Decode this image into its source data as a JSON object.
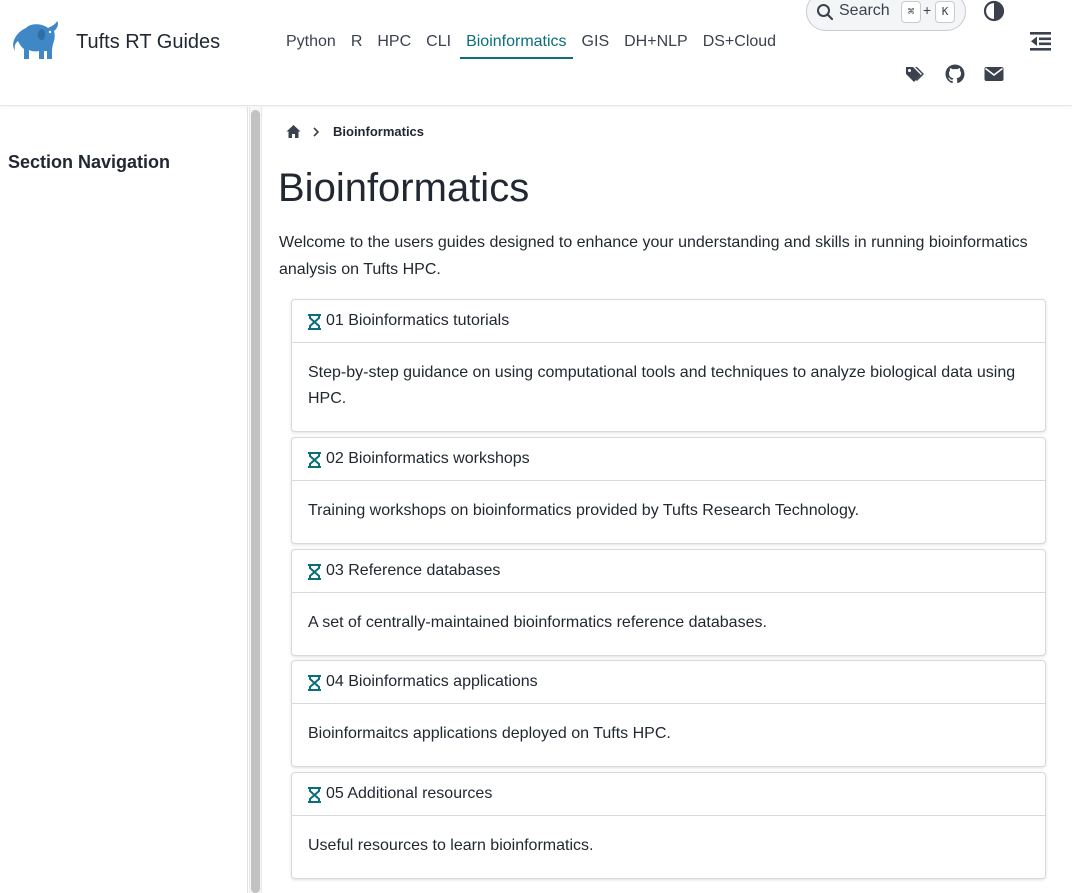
{
  "header": {
    "brand": "Tufts RT Guides",
    "nav": [
      "Python",
      "R",
      "HPC",
      "CLI",
      "Bioinformatics",
      "GIS",
      "DH+NLP",
      "DS+Cloud"
    ],
    "active_nav": "Bioinformatics",
    "search": {
      "label": "Search",
      "shortcut_mod": "⌘",
      "shortcut_plus": "+",
      "shortcut_key": "K"
    },
    "icons": [
      "tags-icon",
      "github-icon",
      "envelope-icon",
      "theme-toggle-icon",
      "toc-toggle-icon",
      "elephant-logo"
    ]
  },
  "sidebar": {
    "title": "Section Navigation"
  },
  "breadcrumb": {
    "current": "Bioinformatics"
  },
  "main": {
    "title": "Bioinformatics",
    "intro": "Welcome to the users guides designed to enhance your understanding and skills in running bioinformatics analysis on Tufts HPC.",
    "cards": [
      {
        "title": "01 Bioinformatics tutorials",
        "body": "Step-by-step guidance on using computational tools and techniques to analyze biological data using HPC."
      },
      {
        "title": "02 Bioinformatics workshops",
        "body": "Training workshops on bioinformatics provided by Tufts Research Technology."
      },
      {
        "title": "03 Reference databases",
        "body": "A set of centrally-maintained bioinformatics reference databases."
      },
      {
        "title": "04 Bioinformatics applications",
        "body": "Bioinformaitcs applications deployed on Tufts HPC."
      },
      {
        "title": "05 Additional resources",
        "body": "Useful resources to learn bioinformatics."
      }
    ]
  },
  "colors": {
    "accent": "#0a6f7a",
    "logo": "#3f88c5",
    "text": "#222832"
  }
}
